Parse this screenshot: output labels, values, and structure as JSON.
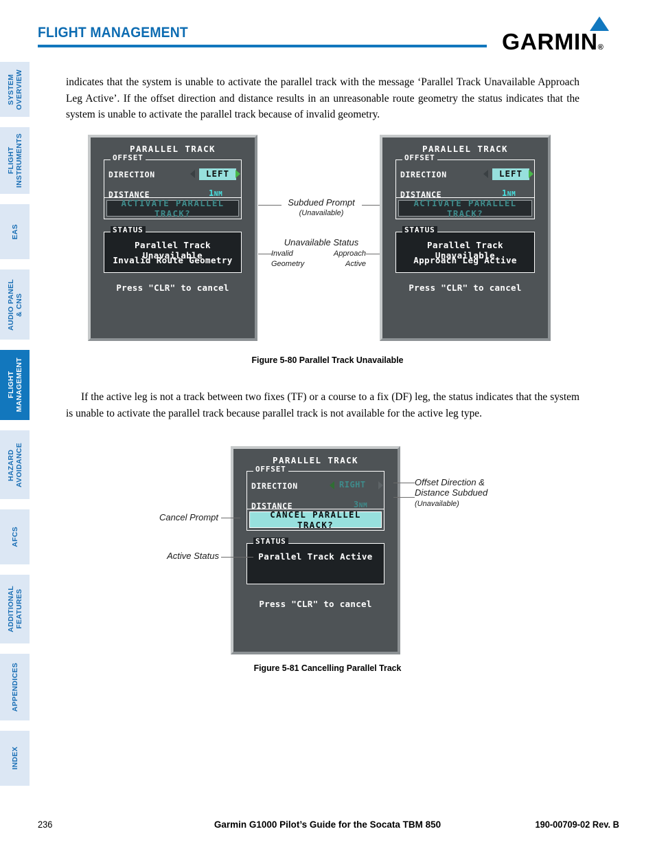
{
  "header": {
    "title": "FLIGHT MANAGEMENT",
    "brand": "GARMIN",
    "brand_mark": "®"
  },
  "sidebar": {
    "items": [
      {
        "label": "SYSTEM\nOVERVIEW",
        "active": false
      },
      {
        "label": "FLIGHT\nINSTRUMENTS",
        "active": false
      },
      {
        "label": "EAS",
        "active": false
      },
      {
        "label": "AUDIO PANEL\n& CNS",
        "active": false
      },
      {
        "label": "FLIGHT\nMANAGEMENT",
        "active": true
      },
      {
        "label": "HAZARD\nAVOIDANCE",
        "active": false
      },
      {
        "label": "AFCS",
        "active": false
      },
      {
        "label": "ADDITIONAL\nFEATURES",
        "active": false
      },
      {
        "label": "APPENDICES",
        "active": false
      },
      {
        "label": "INDEX",
        "active": false
      }
    ]
  },
  "body": {
    "paragraph1": "indicates that the system is unable to activate the parallel track with the message ‘Parallel Track Unavailable Approach Leg Active’.  If the offset direction and distance results in an unreasonable route geometry the status indicates that the system is unable to activate the parallel track because of invalid geometry.",
    "paragraph2": "If the active leg is not a track between two fixes (TF) or a course to a fix (DF) leg, the status indicates that the system is unable to activate the parallel track because parallel track is not available for the active leg type."
  },
  "figure_5_80": {
    "caption": "Figure 5-80  Parallel Track Unavailable",
    "screen_left": {
      "title": "PARALLEL TRACK",
      "offset_group_label": "OFFSET",
      "direction_label": "DIRECTION",
      "direction_value": "LEFT",
      "distance_label": "DISTANCE",
      "distance_value": "1",
      "distance_unit": "NM",
      "prompt": "ACTIVATE PARALLEL TRACK?",
      "status_group_label": "STATUS",
      "status_line1": "Parallel Track Unavailable",
      "status_line2": "Invalid Route Geometry",
      "clr_text": "Press \"CLR\" to cancel"
    },
    "screen_right": {
      "title": "PARALLEL TRACK",
      "offset_group_label": "OFFSET",
      "direction_label": "DIRECTION",
      "direction_value": "LEFT",
      "distance_label": "DISTANCE",
      "distance_value": "1",
      "distance_unit": "NM",
      "prompt": "ACTIVATE PARALLEL TRACK?",
      "status_group_label": "STATUS",
      "status_line1": "Parallel Track Unavailable",
      "status_line2": "Approach Leg Active",
      "clr_text": "Press \"CLR\" to cancel"
    },
    "annotations": {
      "subdued_prompt": "Subdued Prompt",
      "subdued_prompt_sub": "(Unavailable)",
      "unavailable_status": "Unavailable Status",
      "invalid_geometry": "Invalid\nGeometry",
      "approach_active": "Approach\nActive"
    }
  },
  "figure_5_81": {
    "caption": "Figure 5-81  Cancelling Parallel Track",
    "screen": {
      "title": "PARALLEL TRACK",
      "offset_group_label": "OFFSET",
      "direction_label": "DIRECTION",
      "direction_value": "RIGHT",
      "distance_label": "DISTANCE",
      "distance_value": "3",
      "distance_unit": "NM",
      "prompt": "CANCEL PARALLEL TRACK?",
      "status_group_label": "STATUS",
      "status_line1": "Parallel Track Active",
      "clr_text": "Press \"CLR\" to cancel"
    },
    "annotations": {
      "cancel_prompt": "Cancel Prompt",
      "active_status": "Active Status",
      "offset_subdued": "Offset Direction &\nDistance Subdued",
      "offset_subdued_sub": "(Unavailable)"
    }
  },
  "footer": {
    "page_number": "236",
    "title": "Garmin G1000 Pilot’s Guide for the Socata TBM 850",
    "doc_number": "190-00709-02  Rev. B"
  },
  "colors": {
    "brand_blue": "#1277bd",
    "tab_inactive_bg": "#dce7f4",
    "tab_active_bg": "#1277bd",
    "mfd_bg": "#4e5356",
    "mfd_box_bg": "#1d2124",
    "cyan_value": "#49e2e2",
    "cyan_highlight": "#97e0dd",
    "subdued_cyan": "#3f8b8b",
    "arrow_green": "#49b84a"
  }
}
